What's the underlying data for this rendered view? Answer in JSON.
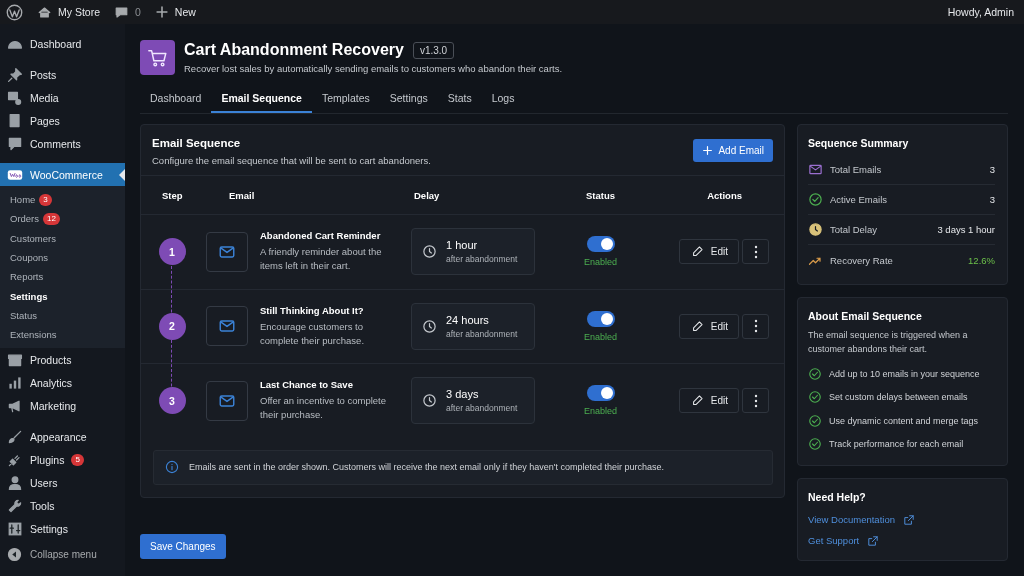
{
  "admin_bar": {
    "site": "My Store",
    "comments": "0",
    "new": "New",
    "greeting": "Howdy, Admin"
  },
  "sidebar": {
    "groups": [
      [
        {
          "label": "Dashboard",
          "selected": false
        }
      ],
      [
        {
          "label": "Posts",
          "selected": false
        },
        {
          "label": "Media",
          "selected": false
        },
        {
          "label": "Pages",
          "selected": false
        },
        {
          "label": "Comments",
          "selected": false
        }
      ],
      [
        {
          "label": "WooCommerce",
          "selected": true,
          "children": [
            {
              "label": "Home",
              "badge": "3",
              "selected": false
            },
            {
              "label": "Orders",
              "badge": "12",
              "selected": false
            },
            {
              "label": "Customers",
              "selected": false
            },
            {
              "label": "Coupons",
              "selected": false
            },
            {
              "label": "Reports",
              "selected": false
            },
            {
              "label": "Settings",
              "selected": true
            },
            {
              "label": "Status",
              "selected": false
            },
            {
              "label": "Extensions",
              "selected": false
            }
          ]
        },
        {
          "label": "Products",
          "selected": false
        },
        {
          "label": "Analytics",
          "selected": false
        },
        {
          "label": "Marketing",
          "selected": false
        }
      ],
      [
        {
          "label": "Appearance",
          "selected": false
        },
        {
          "label": "Plugins",
          "badge": "5",
          "selected": false
        },
        {
          "label": "Users",
          "selected": false
        },
        {
          "label": "Tools",
          "selected": false
        },
        {
          "label": "Settings",
          "selected": false
        }
      ]
    ],
    "collapse": "Collapse menu"
  },
  "header": {
    "title": "Cart Abandonment Recovery",
    "version": "v1.3.0",
    "subtitle": "Recover lost sales by automatically sending emails to customers who abandon their carts."
  },
  "tabs": [
    {
      "label": "Dashboard",
      "selected": false
    },
    {
      "label": "Email Sequence",
      "selected": true
    },
    {
      "label": "Templates",
      "selected": false
    },
    {
      "label": "Settings",
      "selected": false
    },
    {
      "label": "Stats",
      "selected": false
    },
    {
      "label": "Logs",
      "selected": false
    }
  ],
  "sequence": {
    "title": "Email Sequence",
    "subtitle": "Configure the email sequence that will be sent to cart abandoners.",
    "add_button": "Add Email",
    "columns": [
      "Step",
      "Email",
      "Delay",
      "Status",
      "Actions"
    ],
    "rows": [
      {
        "step": "1",
        "title": "Abandoned Cart Reminder",
        "description": "A friendly reminder about the items left in their cart.",
        "delay": "1 hour",
        "delay_note": "after abandonment",
        "on": true,
        "status": "Enabled",
        "edit": "Edit"
      },
      {
        "step": "2",
        "title": "Still Thinking About It?",
        "description": "Encourage customers to complete their purchase.",
        "delay": "24 hours",
        "delay_note": "after abandonment",
        "on": true,
        "status": "Enabled",
        "edit": "Edit"
      },
      {
        "step": "3",
        "title": "Last Chance to Save",
        "description": "Offer an incentive to complete their purchase.",
        "delay": "3 days",
        "delay_note": "after abandonment",
        "on": true,
        "status": "Enabled",
        "edit": "Edit"
      }
    ],
    "note": "Emails are sent in the order shown. Customers will receive the next email only if they haven't completed their purchase."
  },
  "save_button": "Save Changes",
  "summary": {
    "title": "Sequence Summary",
    "items": [
      {
        "kind": "emails",
        "label": "Total Emails",
        "value": "3"
      },
      {
        "kind": "active",
        "label": "Active Emails",
        "value": "3"
      },
      {
        "kind": "delay",
        "label": "Total Delay",
        "value": "3 days 1 hour"
      },
      {
        "kind": "rate",
        "label": "Recovery Rate",
        "value": "12.6%"
      }
    ]
  },
  "about": {
    "title": "About Email Sequence",
    "text": "The email sequence is triggered when a customer abandons their cart.",
    "points": [
      "Add up to 10 emails in your sequence",
      "Set custom delays between emails",
      "Use dynamic content and merge tags",
      "Track performance for each email"
    ]
  },
  "help": {
    "title": "Need Help?",
    "links": [
      "View Documentation",
      "Get Support"
    ]
  }
}
